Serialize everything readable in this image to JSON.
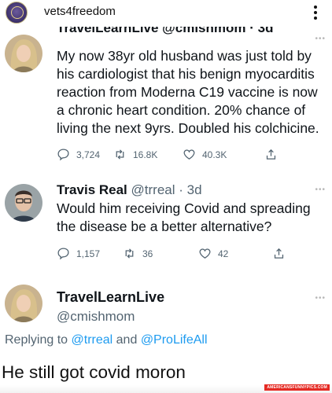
{
  "post": {
    "account_handle": "vets4freedom",
    "more_icon": "kebab-menu-icon"
  },
  "tweets": [
    {
      "header_partial": "TravelLearnLive @cmishmom · 3d",
      "text": "My now 38yr old husband was just told by his cardiologist that his benign myocarditis reaction from Moderna C19 vaccine is now a chronic heart condition. 20% chance of living the next 9yrs. Doubled his colchicine.",
      "replies": "3,724",
      "retweets": "16.8K",
      "likes": "40.3K"
    },
    {
      "name": "Travis Real",
      "handle": "@trreal",
      "time": "3d",
      "text": "Would him receiving Covid and spreading the disease be a better alternative?",
      "replies": "1,157",
      "retweets": "36",
      "likes": "42"
    },
    {
      "name": "TravelLearnLive",
      "handle": "@cmishmom"
    }
  ],
  "replying": {
    "prefix": "Replying to",
    "mention1": "@trreal",
    "and": "and",
    "mention2": "@ProLifeAll"
  },
  "caption": "He still got covid moron",
  "watermark": "AMERICANSFUNNYPICS.COM",
  "colors": {
    "link": "#1d9bf0",
    "meta": "#536471",
    "text": "#0f1419"
  }
}
